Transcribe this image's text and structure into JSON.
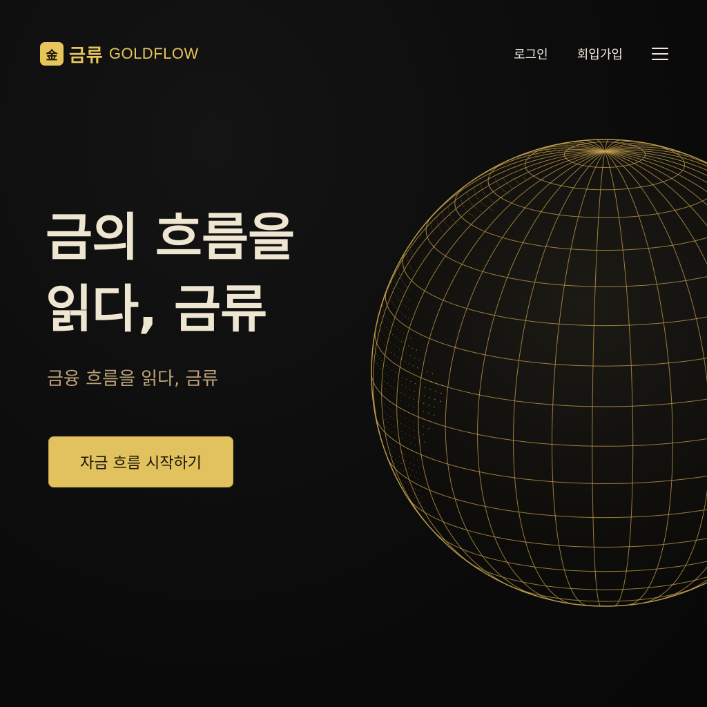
{
  "brand": {
    "logo_symbol": "金",
    "name_ko": "금류",
    "name_en": "GOLDFLOW"
  },
  "nav": {
    "login_label": "로그인",
    "signup_label": "회입가입",
    "menu_icon": "hamburger-menu-icon"
  },
  "hero": {
    "title_line1": "금의 흐름을",
    "title_line2": "읽다, 금류",
    "subtitle": "금융 흐름을 읽다, 금류",
    "cta_label": "자금 흐름 시작하기"
  },
  "colors": {
    "background": "#0b0b0b",
    "accent_gold": "#e7c55a",
    "title_cream": "#efe6d2",
    "subtitle_tan": "#bfa27a",
    "globe_line": "#c8a24e"
  }
}
